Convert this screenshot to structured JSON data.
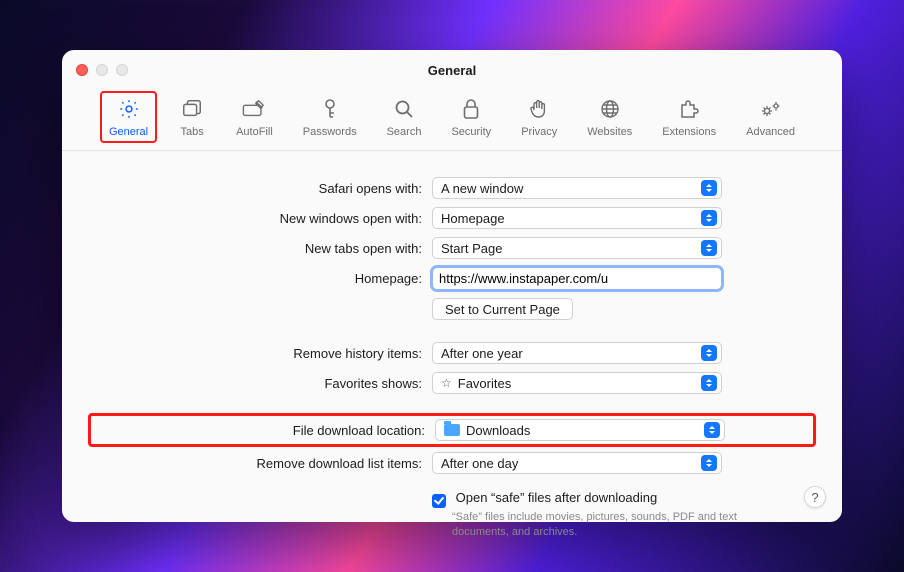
{
  "window": {
    "title": "General"
  },
  "toolbar": {
    "items": [
      {
        "name": "general",
        "label": "General"
      },
      {
        "name": "tabs",
        "label": "Tabs"
      },
      {
        "name": "autofill",
        "label": "AutoFill"
      },
      {
        "name": "passwords",
        "label": "Passwords"
      },
      {
        "name": "search",
        "label": "Search"
      },
      {
        "name": "security",
        "label": "Security"
      },
      {
        "name": "privacy",
        "label": "Privacy"
      },
      {
        "name": "websites",
        "label": "Websites"
      },
      {
        "name": "extensions",
        "label": "Extensions"
      },
      {
        "name": "advanced",
        "label": "Advanced"
      }
    ]
  },
  "rows": {
    "safari_opens_with": {
      "label": "Safari opens with:",
      "value": "A new window"
    },
    "new_windows_open_with": {
      "label": "New windows open with:",
      "value": "Homepage"
    },
    "new_tabs_open_with": {
      "label": "New tabs open with:",
      "value": "Start Page"
    },
    "homepage": {
      "label": "Homepage:",
      "value": "https://www.instapaper.com/u"
    },
    "set_current_page_btn": "Set to Current Page",
    "remove_history": {
      "label": "Remove history items:",
      "value": "After one year"
    },
    "favorites_shows": {
      "label": "Favorites shows:",
      "value": "Favorites"
    },
    "file_download_location": {
      "label": "File download location:",
      "value": "Downloads"
    },
    "remove_download_list": {
      "label": "Remove download list items:",
      "value": "After one day"
    },
    "open_safe_files": {
      "label": "Open “safe” files after downloading",
      "checked": true,
      "hint": "“Safe” files include movies, pictures, sounds, PDF and text documents, and archives."
    }
  },
  "help_button": "?"
}
